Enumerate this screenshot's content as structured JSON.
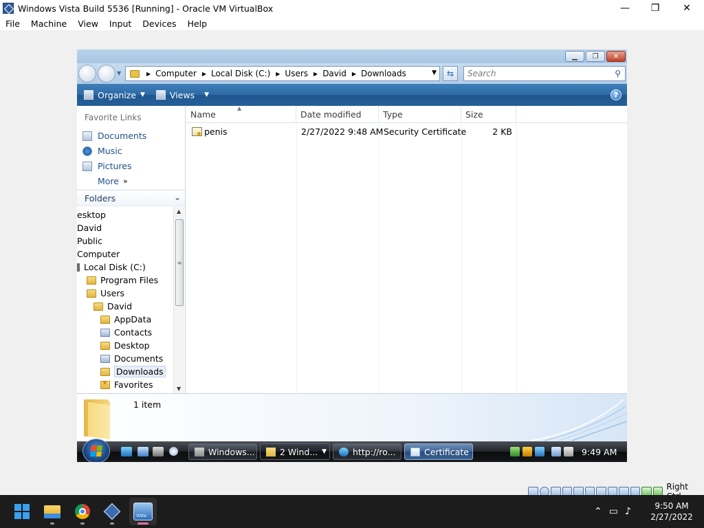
{
  "host": {
    "window_title": "Windows Vista Build 5536 [Running] - Oracle VM VirtualBox",
    "menu": [
      "File",
      "Machine",
      "View",
      "Input",
      "Devices",
      "Help"
    ],
    "controls": {
      "minimize": "—",
      "restore": "❐",
      "close": "✕"
    },
    "status_hostkey": "Right Ctrl",
    "taskbar": {
      "apps": [
        "windows-start",
        "file-explorer",
        "google-chrome",
        "virtualbox-manager",
        "vista-vm"
      ],
      "tray_icons": [
        "chevron-up-icon",
        "network-icon",
        "volume-icon"
      ],
      "time": "9:50 AM",
      "date": "2/27/2022"
    }
  },
  "explorer": {
    "breadcrumb": [
      "Computer",
      "Local Disk (C:)",
      "Users",
      "David",
      "Downloads"
    ],
    "search_placeholder": "Search",
    "commands": {
      "organize": "Organize",
      "views": "Views",
      "help": "?"
    },
    "favorite_links_title": "Favorite Links",
    "favorite_links": [
      "Documents",
      "Music",
      "Pictures"
    ],
    "more_label": "More",
    "folders_label": "Folders",
    "tree": [
      {
        "label": "esktop",
        "indent": 0,
        "icon": "none"
      },
      {
        "label": "David",
        "indent": 0,
        "icon": "none"
      },
      {
        "label": "Public",
        "indent": 0,
        "icon": "none"
      },
      {
        "label": "Computer",
        "indent": 0,
        "icon": "none"
      },
      {
        "label": "Local Disk (C:)",
        "indent": 0,
        "icon": "drive"
      },
      {
        "label": "Program Files",
        "indent": 1,
        "icon": "folder"
      },
      {
        "label": "Users",
        "indent": 1,
        "icon": "folder"
      },
      {
        "label": "David",
        "indent": 2,
        "icon": "folder"
      },
      {
        "label": "AppData",
        "indent": 3,
        "icon": "folder"
      },
      {
        "label": "Contacts",
        "indent": 3,
        "icon": "doc"
      },
      {
        "label": "Desktop",
        "indent": 3,
        "icon": "folder"
      },
      {
        "label": "Documents",
        "indent": 3,
        "icon": "doc"
      },
      {
        "label": "Downloads",
        "indent": 3,
        "icon": "folder",
        "selected": true
      },
      {
        "label": "Favorites",
        "indent": 3,
        "icon": "fav"
      }
    ],
    "columns": [
      "Name",
      "Date modified",
      "Type",
      "Size"
    ],
    "files": [
      {
        "name": "penis",
        "date_modified": "2/27/2022 9:48 AM",
        "type": "Security Certificate",
        "size": "2 KB"
      }
    ],
    "status_count": "1 item"
  },
  "vista_taskbar": {
    "buttons": [
      {
        "label": "Windows...",
        "icon": "tools-icon",
        "state": "normal"
      },
      {
        "label": "2 Wind...",
        "icon": "folder-icon",
        "state": "group"
      },
      {
        "label": "http://ro...",
        "icon": "ie-icon",
        "state": "normal"
      },
      {
        "label": "Certificate",
        "icon": "certificate-window-icon",
        "state": "active"
      }
    ],
    "time": "9:49 AM"
  },
  "colors": {
    "accent_blue": "#2d6aa6",
    "link_blue": "#1e4f8b",
    "active_taskbar_marker": "#e66ea8"
  }
}
